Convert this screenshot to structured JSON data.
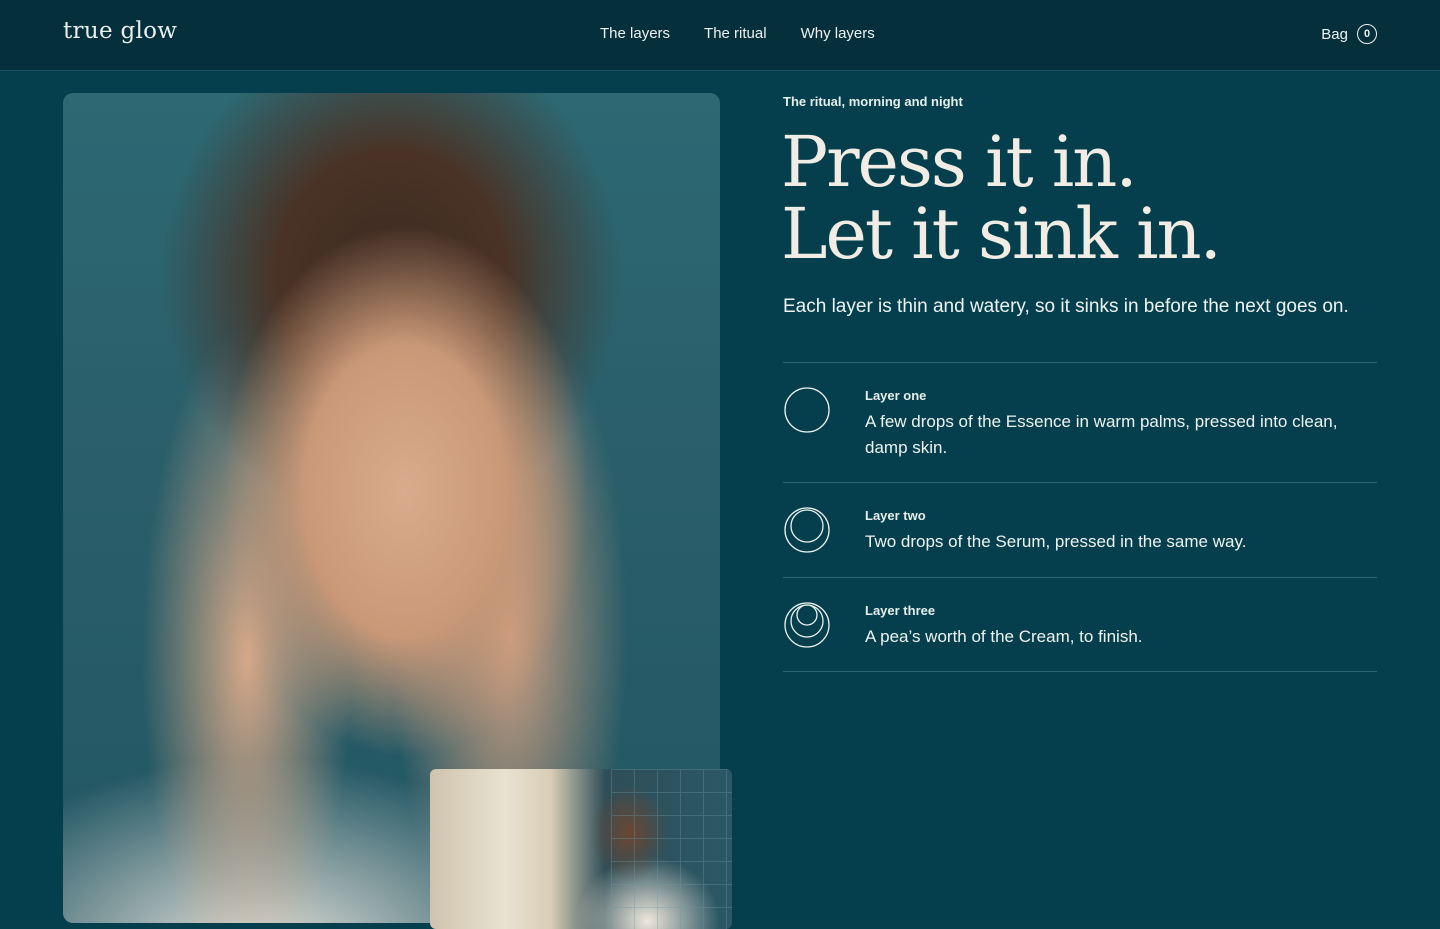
{
  "header": {
    "logo": "true glow",
    "nav": [
      "The layers",
      "The ritual",
      "Why layers"
    ],
    "bag_label": "Bag",
    "bag_count": "0"
  },
  "hero": {
    "eyebrow": "The ritual, morning and night",
    "headline_line1": "Press it in.",
    "headline_line2": "Let it sink in.",
    "intro": "Each layer is thin and watery, so it sinks in before the next goes on."
  },
  "layers": [
    {
      "name": "Layer one",
      "desc": "A few drops of the Essence in warm palms, pressed into clean, damp skin.",
      "icon": "single-circle-icon"
    },
    {
      "name": "Layer two",
      "desc": "Two drops of the Serum, pressed in the same way.",
      "icon": "double-circle-icon"
    },
    {
      "name": "Layer three",
      "desc": "A pea’s worth of the Cream, to finish.",
      "icon": "triple-circle-icon"
    }
  ],
  "images": {
    "main": "woman-pressing-hands-to-cheeks-photo",
    "inset": "man-looking-out-window-photo"
  },
  "colors": {
    "background": "#053f4d",
    "header": "#042f3b",
    "headline": "#f1ece4",
    "text": "#eef3f1"
  }
}
